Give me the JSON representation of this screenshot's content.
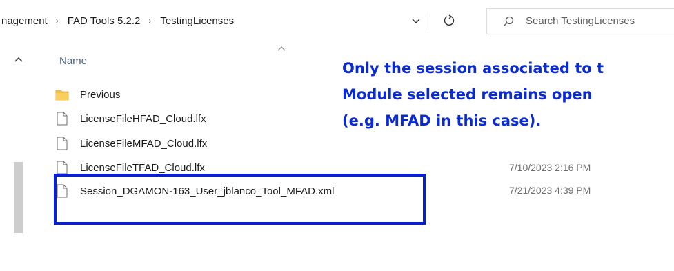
{
  "address_bar": {
    "breadcrumbs": [
      "nagement",
      "FAD Tools 5.2.2",
      "TestingLicenses"
    ],
    "separator": "›"
  },
  "search": {
    "placeholder": "Search TestingLicenses"
  },
  "column_header": {
    "name": "Name"
  },
  "files": [
    {
      "name": "Previous",
      "type": "folder-icon",
      "date": ""
    },
    {
      "name": "LicenseFileHFAD_Cloud.lfx",
      "type": "file-icon",
      "date": ""
    },
    {
      "name": "LicenseFileMFAD_Cloud.lfx",
      "type": "file-icon",
      "date": ""
    },
    {
      "name": "LicenseFileTFAD_Cloud.lfx",
      "type": "file-icon",
      "date": "7/10/2023 2:16 PM"
    },
    {
      "name": "Session_DGAMON-163_User_jblanco_Tool_MFAD.xml",
      "type": "file-icon",
      "date": "7/21/2023 4:39 PM"
    }
  ],
  "annotation": {
    "lines": [
      "Only the session associated to t",
      "Module selected remains open",
      "(e.g. MFAD in this case)."
    ],
    "color": "#0a2bd4",
    "box_color": "#0a1fd0"
  }
}
